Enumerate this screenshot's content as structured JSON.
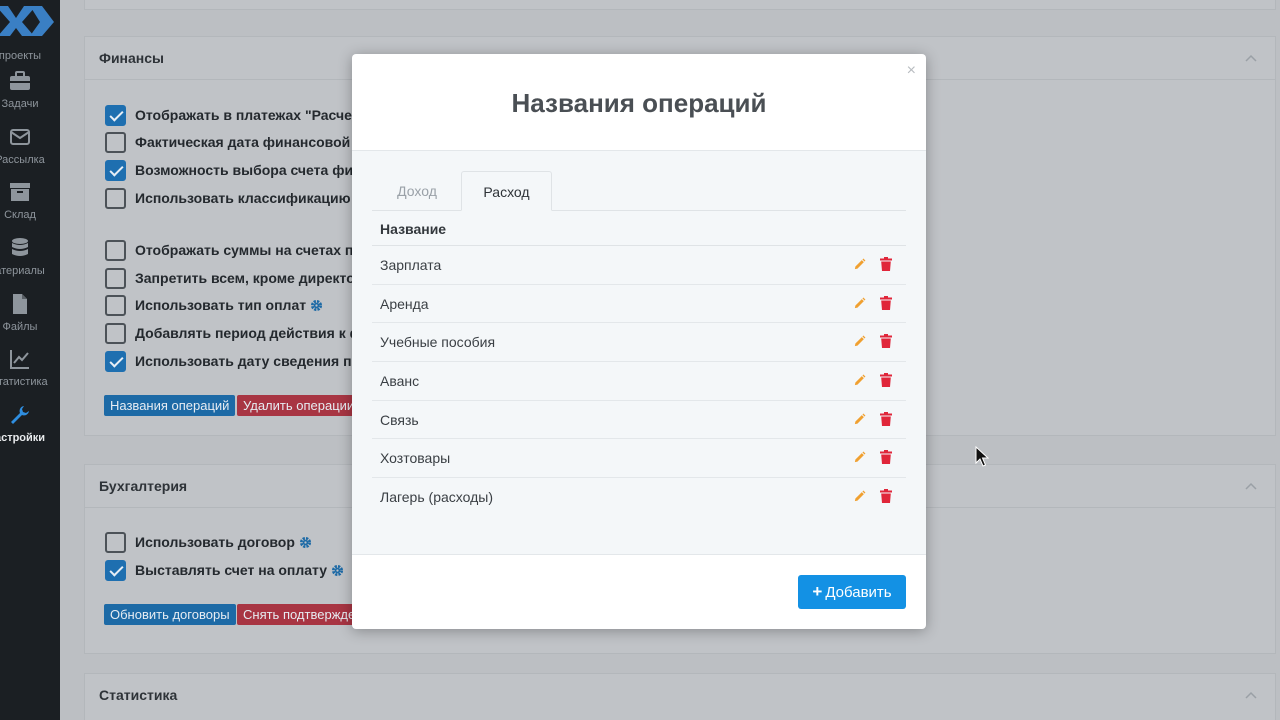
{
  "sidebar": {
    "items": [
      {
        "label": "проекты",
        "icon": "grid-icon"
      },
      {
        "label": "Задачи",
        "icon": "briefcase-icon"
      },
      {
        "label": "Рассылка",
        "icon": "envelope-icon"
      },
      {
        "label": "Склад",
        "icon": "archive-icon"
      },
      {
        "label": "атериалы",
        "icon": "database-icon"
      },
      {
        "label": "Файлы",
        "icon": "file-icon"
      },
      {
        "label": "статистика",
        "icon": "chart-line-icon"
      },
      {
        "label": "астройки",
        "icon": "wrench-icon",
        "active": true
      }
    ]
  },
  "finance": {
    "title": "Финансы",
    "options": [
      {
        "label": "Отображать в платежах \"Расчет",
        "checked": true
      },
      {
        "label": "Фактическая дата финансовой о",
        "checked": false
      },
      {
        "label": "Возможность выбора счета фин",
        "checked": true
      },
      {
        "label": "Использовать классификацию о",
        "checked": false
      },
      {
        "label": "Отображать суммы на счетах пр",
        "checked": false
      },
      {
        "label": "Запретить всем, кроме директо",
        "checked": false
      },
      {
        "label": "Использовать тип оплат",
        "checked": false,
        "gear": true
      },
      {
        "label": "Добавлять период действия к ф",
        "checked": false
      },
      {
        "label": "Использовать дату сведения по",
        "checked": true
      }
    ],
    "btn_operations": "Названия операций",
    "btn_delete": "Удалить операции"
  },
  "accounting": {
    "title": "Бухгалтерия",
    "options": [
      {
        "label": "Использовать договор",
        "checked": false,
        "gear": true
      },
      {
        "label": "Выставлять счет на оплату",
        "checked": true,
        "gear": true
      }
    ],
    "btn_update": "Обновить договоры",
    "btn_unconfirm": "Снять подтвержде"
  },
  "statistics": {
    "title": "Статистика"
  },
  "modal": {
    "title": "Названия операций",
    "close": "×",
    "tabs": [
      {
        "label": "Доход",
        "active": false
      },
      {
        "label": "Расход",
        "active": true
      }
    ],
    "column_header": "Название",
    "rows": [
      "Зарплата",
      "Аренда",
      "Учебные пособия",
      "Аванс",
      "Связь",
      "Хозтовары",
      "Лагерь (расходы)"
    ],
    "add_label": "Добавить",
    "add_plus": "+"
  },
  "colors": {
    "accent_blue": "#1391e4",
    "edit_icon": "#f0a030",
    "delete_icon": "#e0263a",
    "sidebar_bg": "#1b1f23"
  }
}
